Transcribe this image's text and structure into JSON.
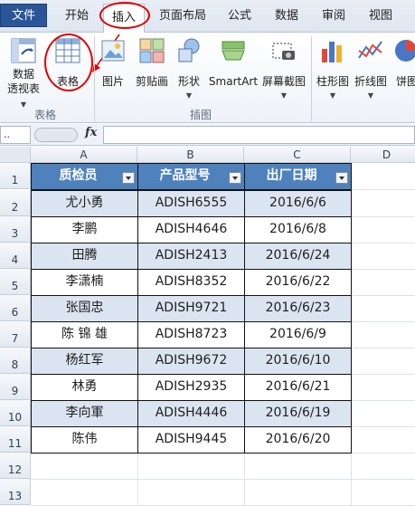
{
  "tabs": [
    {
      "label": "文件"
    },
    {
      "label": "开始"
    },
    {
      "label": "插入"
    },
    {
      "label": "页面布局"
    },
    {
      "label": "公式"
    },
    {
      "label": "数据"
    },
    {
      "label": "审阅"
    },
    {
      "label": "视图"
    }
  ],
  "ribbon": {
    "pivot_line1": "数据",
    "pivot_line2": "透视表",
    "table_label": "表格",
    "picture_label": "图片",
    "clipart_label": "剪贴画",
    "shapes_label": "形状",
    "smartart_label": "SmartArt",
    "screenshot_label": "屏幕截图",
    "column_label": "柱形图",
    "line_label": "折线图",
    "pie_label": "饼图",
    "group_tables": "表格",
    "group_illustrations": "插图"
  },
  "formula_bar": {
    "name_box": "..",
    "fx_label": "fx",
    "content": ""
  },
  "sheet": {
    "columns": [
      "A",
      "B",
      "C",
      "D"
    ],
    "rows": [
      "1",
      "2",
      "3",
      "4",
      "5",
      "6",
      "7",
      "8",
      "9",
      "10",
      "11",
      "12",
      "13"
    ],
    "headers": [
      "质检员",
      "产品型号",
      "出厂日期"
    ],
    "data": [
      [
        "尤小勇",
        "ADISH6555",
        "2016/6/6"
      ],
      [
        "李鹏",
        "ADISH4646",
        "2016/6/8"
      ],
      [
        "田腾",
        "ADISH2413",
        "2016/6/24"
      ],
      [
        "李潇楠",
        "ADISH8352",
        "2016/6/22"
      ],
      [
        "张国忠",
        "ADISH9721",
        "2016/6/23"
      ],
      [
        "陈 锦 雄",
        "ADISH8723",
        "2016/6/9"
      ],
      [
        "杨红军",
        "ADISH9672",
        "2016/6/10"
      ],
      [
        "林勇",
        "ADISH2935",
        "2016/6/21"
      ],
      [
        "李向軍",
        "ADISH4446",
        "2016/6/19"
      ],
      [
        "陈伟",
        "ADISH9445",
        "2016/6/20"
      ]
    ]
  },
  "colors": {
    "header_fill": "#4f81bd",
    "band_fill": "#dbe5f1",
    "annotation": "#e00000"
  }
}
